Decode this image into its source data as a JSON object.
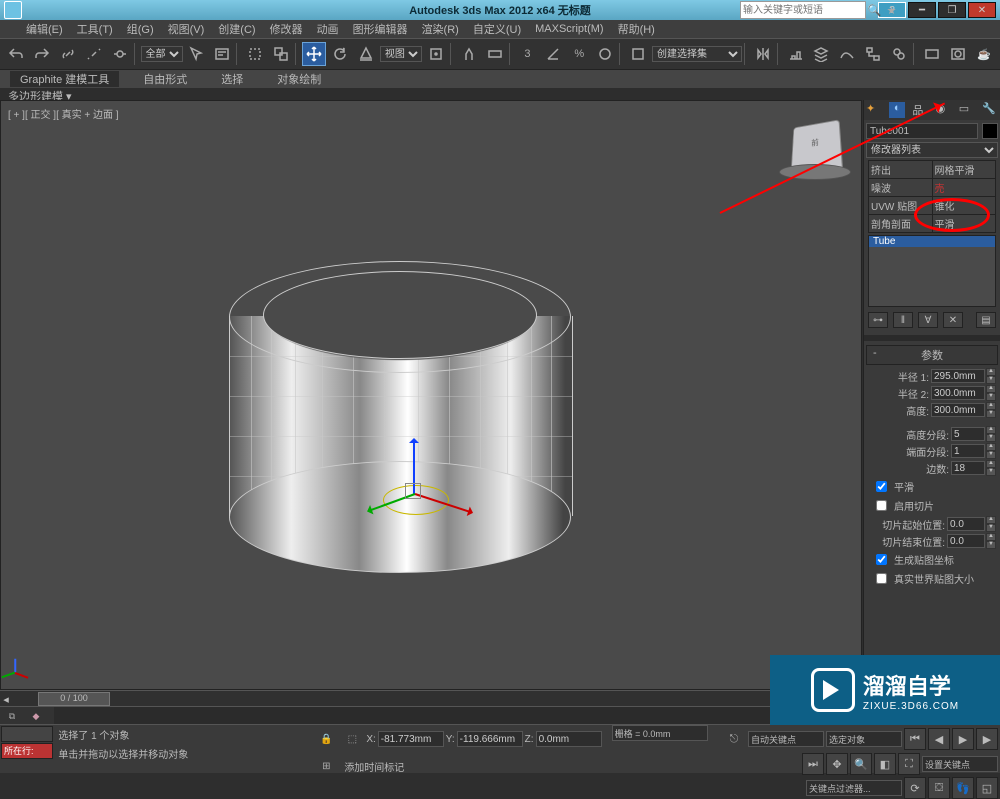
{
  "titlebar": {
    "title": "Autodesk 3ds Max 2012 x64   无标题",
    "search_ph": "输入关键字或短语"
  },
  "menu": [
    "编辑(E)",
    "工具(T)",
    "组(G)",
    "视图(V)",
    "创建(C)",
    "修改器",
    "动画",
    "图形编辑器",
    "渲染(R)",
    "自定义(U)",
    "MAXScript(M)",
    "帮助(H)"
  ],
  "toolbar": {
    "all": "全部",
    "view": "视图",
    "selset": "创建选择集"
  },
  "ribbon": {
    "tabs": [
      "Graphite 建模工具",
      "自由形式",
      "选择",
      "对象绘制"
    ],
    "sub": "多边形建模"
  },
  "viewport": {
    "label": "[ + ][ 正交 ][ 真实 + 边面 ]",
    "cube": "前"
  },
  "cmd": {
    "obj": "Tube001",
    "modlist": "修改器列表",
    "mods": [
      [
        "挤出",
        "网格平滑"
      ],
      [
        "噪波",
        "売"
      ],
      [
        "UVW 贴图",
        "锥化"
      ],
      [
        "剖角剖面",
        "平滑"
      ]
    ],
    "stack_sel": "Tube",
    "rollout": "参数",
    "r1": "半径 1:",
    "r1v": "295.0mm",
    "r2": "半径 2:",
    "r2v": "300.0mm",
    "h": "高度:",
    "hv": "300.0mm",
    "hs": "高度分段:",
    "hsv": "5",
    "cs": "端面分段:",
    "csv": "1",
    "ss": "边数:",
    "ssv": "18",
    "smooth": "平滑",
    "slice": "启用切片",
    "sstart": "切片起始位置:",
    "sstartv": "0.0",
    "send": "切片结束位置:",
    "sendv": "0.0",
    "gen": "生成贴图坐标",
    "real": "真实世界贴图大小"
  },
  "timeslider": "0 / 100",
  "status": {
    "sel": "选择了 1 个对象",
    "hint": "单击并拖动以选择并移动对象",
    "now": "所在行:",
    "add_time": "添加时间标记",
    "x": "X:",
    "xv": "-81.773mm",
    "y": "Y:",
    "yv": "-119.666mm",
    "z": "Z:",
    "zv": "0.0mm",
    "grid": "栅格 = 0.0mm",
    "auto": "自动关键点",
    "selset": "选定对象",
    "setkey": "设置关键点",
    "filter": "关键点过滤器..."
  },
  "watermark": {
    "big": "溜溜自学",
    "small": "ZIXUE.3D66.COM"
  }
}
